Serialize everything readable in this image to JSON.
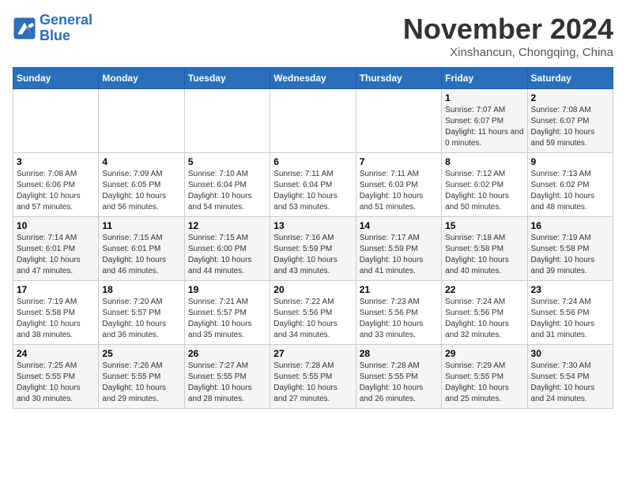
{
  "header": {
    "logo_line1": "General",
    "logo_line2": "Blue",
    "month_title": "November 2024",
    "location": "Xinshancun, Chongqing, China"
  },
  "weekdays": [
    "Sunday",
    "Monday",
    "Tuesday",
    "Wednesday",
    "Thursday",
    "Friday",
    "Saturday"
  ],
  "weeks": [
    [
      {
        "day": "",
        "info": ""
      },
      {
        "day": "",
        "info": ""
      },
      {
        "day": "",
        "info": ""
      },
      {
        "day": "",
        "info": ""
      },
      {
        "day": "",
        "info": ""
      },
      {
        "day": "1",
        "info": "Sunrise: 7:07 AM\nSunset: 6:07 PM\nDaylight: 11 hours and 0 minutes."
      },
      {
        "day": "2",
        "info": "Sunrise: 7:08 AM\nSunset: 6:07 PM\nDaylight: 10 hours and 59 minutes."
      }
    ],
    [
      {
        "day": "3",
        "info": "Sunrise: 7:08 AM\nSunset: 6:06 PM\nDaylight: 10 hours and 57 minutes."
      },
      {
        "day": "4",
        "info": "Sunrise: 7:09 AM\nSunset: 6:05 PM\nDaylight: 10 hours and 56 minutes."
      },
      {
        "day": "5",
        "info": "Sunrise: 7:10 AM\nSunset: 6:04 PM\nDaylight: 10 hours and 54 minutes."
      },
      {
        "day": "6",
        "info": "Sunrise: 7:11 AM\nSunset: 6:04 PM\nDaylight: 10 hours and 53 minutes."
      },
      {
        "day": "7",
        "info": "Sunrise: 7:11 AM\nSunset: 6:03 PM\nDaylight: 10 hours and 51 minutes."
      },
      {
        "day": "8",
        "info": "Sunrise: 7:12 AM\nSunset: 6:02 PM\nDaylight: 10 hours and 50 minutes."
      },
      {
        "day": "9",
        "info": "Sunrise: 7:13 AM\nSunset: 6:02 PM\nDaylight: 10 hours and 48 minutes."
      }
    ],
    [
      {
        "day": "10",
        "info": "Sunrise: 7:14 AM\nSunset: 6:01 PM\nDaylight: 10 hours and 47 minutes."
      },
      {
        "day": "11",
        "info": "Sunrise: 7:15 AM\nSunset: 6:01 PM\nDaylight: 10 hours and 46 minutes."
      },
      {
        "day": "12",
        "info": "Sunrise: 7:15 AM\nSunset: 6:00 PM\nDaylight: 10 hours and 44 minutes."
      },
      {
        "day": "13",
        "info": "Sunrise: 7:16 AM\nSunset: 5:59 PM\nDaylight: 10 hours and 43 minutes."
      },
      {
        "day": "14",
        "info": "Sunrise: 7:17 AM\nSunset: 5:59 PM\nDaylight: 10 hours and 41 minutes."
      },
      {
        "day": "15",
        "info": "Sunrise: 7:18 AM\nSunset: 5:58 PM\nDaylight: 10 hours and 40 minutes."
      },
      {
        "day": "16",
        "info": "Sunrise: 7:19 AM\nSunset: 5:58 PM\nDaylight: 10 hours and 39 minutes."
      }
    ],
    [
      {
        "day": "17",
        "info": "Sunrise: 7:19 AM\nSunset: 5:58 PM\nDaylight: 10 hours and 38 minutes."
      },
      {
        "day": "18",
        "info": "Sunrise: 7:20 AM\nSunset: 5:57 PM\nDaylight: 10 hours and 36 minutes."
      },
      {
        "day": "19",
        "info": "Sunrise: 7:21 AM\nSunset: 5:57 PM\nDaylight: 10 hours and 35 minutes."
      },
      {
        "day": "20",
        "info": "Sunrise: 7:22 AM\nSunset: 5:56 PM\nDaylight: 10 hours and 34 minutes."
      },
      {
        "day": "21",
        "info": "Sunrise: 7:23 AM\nSunset: 5:56 PM\nDaylight: 10 hours and 33 minutes."
      },
      {
        "day": "22",
        "info": "Sunrise: 7:24 AM\nSunset: 5:56 PM\nDaylight: 10 hours and 32 minutes."
      },
      {
        "day": "23",
        "info": "Sunrise: 7:24 AM\nSunset: 5:56 PM\nDaylight: 10 hours and 31 minutes."
      }
    ],
    [
      {
        "day": "24",
        "info": "Sunrise: 7:25 AM\nSunset: 5:55 PM\nDaylight: 10 hours and 30 minutes."
      },
      {
        "day": "25",
        "info": "Sunrise: 7:26 AM\nSunset: 5:55 PM\nDaylight: 10 hours and 29 minutes."
      },
      {
        "day": "26",
        "info": "Sunrise: 7:27 AM\nSunset: 5:55 PM\nDaylight: 10 hours and 28 minutes."
      },
      {
        "day": "27",
        "info": "Sunrise: 7:28 AM\nSunset: 5:55 PM\nDaylight: 10 hours and 27 minutes."
      },
      {
        "day": "28",
        "info": "Sunrise: 7:28 AM\nSunset: 5:55 PM\nDaylight: 10 hours and 26 minutes."
      },
      {
        "day": "29",
        "info": "Sunrise: 7:29 AM\nSunset: 5:55 PM\nDaylight: 10 hours and 25 minutes."
      },
      {
        "day": "30",
        "info": "Sunrise: 7:30 AM\nSunset: 5:54 PM\nDaylight: 10 hours and 24 minutes."
      }
    ]
  ]
}
